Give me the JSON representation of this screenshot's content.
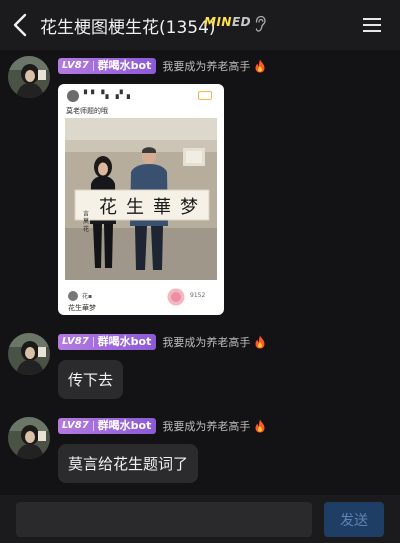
{
  "header": {
    "title": "花生梗图梗生花(1354)",
    "badge": {
      "main": "MIN",
      "suffix": "ED"
    }
  },
  "messages": [
    {
      "level": "LV87",
      "sender": "群喝水bot",
      "sender_title": "我要成为养老高手",
      "image": {
        "post_user": "▘▘▝▖▗▘▖",
        "post_caption": "莫老师题的哦",
        "calligraphy_left": "言 莫 花",
        "calligraphy_main": "花生華梦",
        "bottom_user": "花▪",
        "bottom_caption": "花生華梦",
        "likes": "9152"
      }
    },
    {
      "level": "LV87",
      "sender": "群喝水bot",
      "sender_title": "我要成为养老高手",
      "text": "传下去"
    },
    {
      "level": "LV87",
      "sender": "群喝水bot",
      "sender_title": "我要成为养老高手",
      "text": "莫言给花生题词了"
    }
  ],
  "footer": {
    "input_value": "",
    "send_label": "发送"
  },
  "colors": {
    "background": "#131315",
    "bar": "#1b1b1e",
    "bubble": "#2b2b2e",
    "level_badge": "#9c6be0",
    "send_button": "#1f3e66"
  }
}
